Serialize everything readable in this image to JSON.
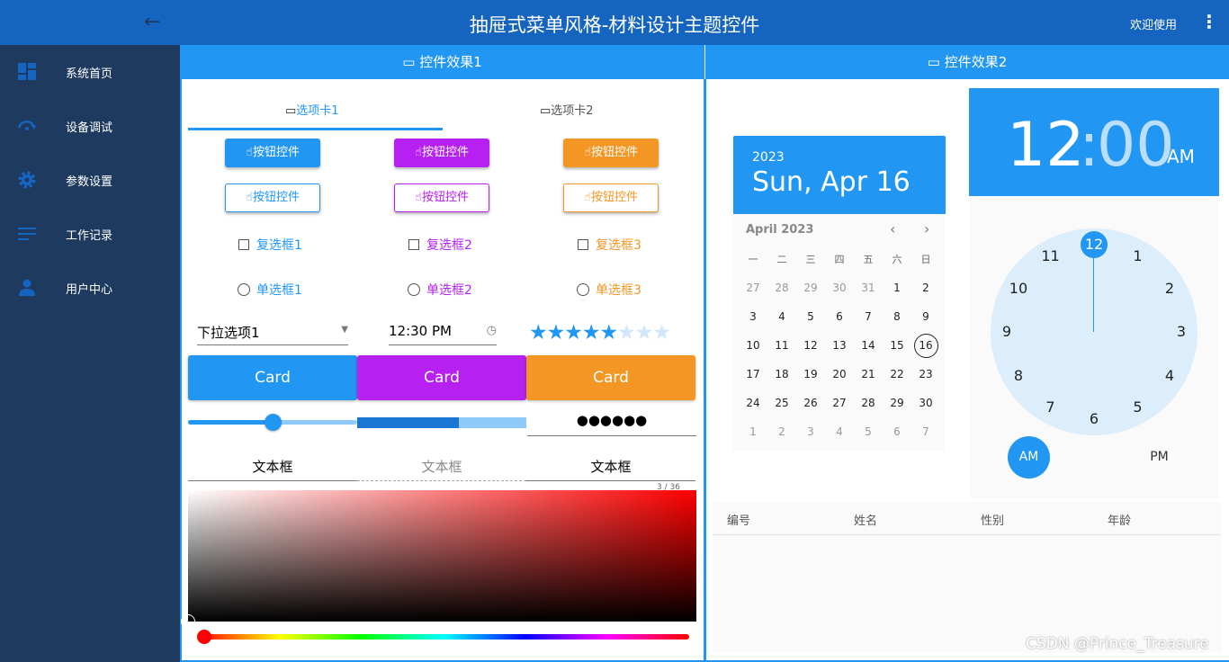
{
  "app": {
    "title": "抽屉式菜单风格-材料设计主题控件",
    "welcome": "欢迎使用",
    "back_icon": "arrow-left-icon",
    "more_icon": "more-vert-icon"
  },
  "sidebar": {
    "items": [
      {
        "label": "系统首页",
        "icon": "dashboard-icon"
      },
      {
        "label": "设备调试",
        "icon": "gauge-icon"
      },
      {
        "label": "参数设置",
        "icon": "gear-icon"
      },
      {
        "label": "工作记录",
        "icon": "notes-icon"
      },
      {
        "label": "用户中心",
        "icon": "person-icon"
      }
    ]
  },
  "panel1": {
    "title": "控件效果1",
    "tabs": [
      {
        "label": "选项卡1"
      },
      {
        "label": "选项卡2"
      }
    ],
    "button_label": "按钮控件",
    "checkboxes": [
      "复选框1",
      "复选框2",
      "复选框3"
    ],
    "radios": [
      "单选框1",
      "单选框2",
      "单选框3"
    ],
    "dropdown": {
      "value": "下拉选项1"
    },
    "time": {
      "value": "12:30 PM"
    },
    "rating": {
      "value": 5,
      "max": 8
    },
    "cards": [
      "Card",
      "Card",
      "Card"
    ],
    "slider": {
      "value": 0.5
    },
    "progress": {
      "value": 0.6
    },
    "password": "●●●●●●",
    "textboxes": [
      "文本框",
      "文本框",
      "文本框"
    ],
    "counter": "3 / 36"
  },
  "panel2": {
    "title": "控件效果2",
    "date": {
      "year": "2023",
      "display": "Sun, Apr 16",
      "month": "April 2023",
      "weekdays": [
        "一",
        "二",
        "三",
        "四",
        "五",
        "六",
        "日"
      ],
      "weeks": [
        [
          "27",
          "28",
          "29",
          "30",
          "31",
          "1",
          "2"
        ],
        [
          "3",
          "4",
          "5",
          "6",
          "7",
          "8",
          "9"
        ],
        [
          "10",
          "11",
          "12",
          "13",
          "14",
          "15",
          "16"
        ],
        [
          "17",
          "18",
          "19",
          "20",
          "21",
          "22",
          "23"
        ],
        [
          "24",
          "25",
          "26",
          "27",
          "28",
          "29",
          "30"
        ],
        [
          "1",
          "2",
          "3",
          "4",
          "5",
          "6",
          "7"
        ]
      ],
      "selected": "16"
    },
    "clock": {
      "hour": "12",
      "sep": ":",
      "minute": "00",
      "ampm": "AM",
      "numbers": [
        "12",
        "1",
        "2",
        "3",
        "4",
        "5",
        "6",
        "7",
        "8",
        "9",
        "10",
        "11"
      ],
      "am": "AM",
      "pm": "PM"
    },
    "table": {
      "columns": [
        "编号",
        "姓名",
        "性别",
        "年龄"
      ]
    }
  },
  "watermark": "CSDN @Prince_Treasure",
  "colors": {
    "blue": "#2196f3",
    "purple": "#b620f0",
    "orange": "#f39623",
    "sidebar": "#1e3a5f",
    "topbar": "#1565c0"
  }
}
